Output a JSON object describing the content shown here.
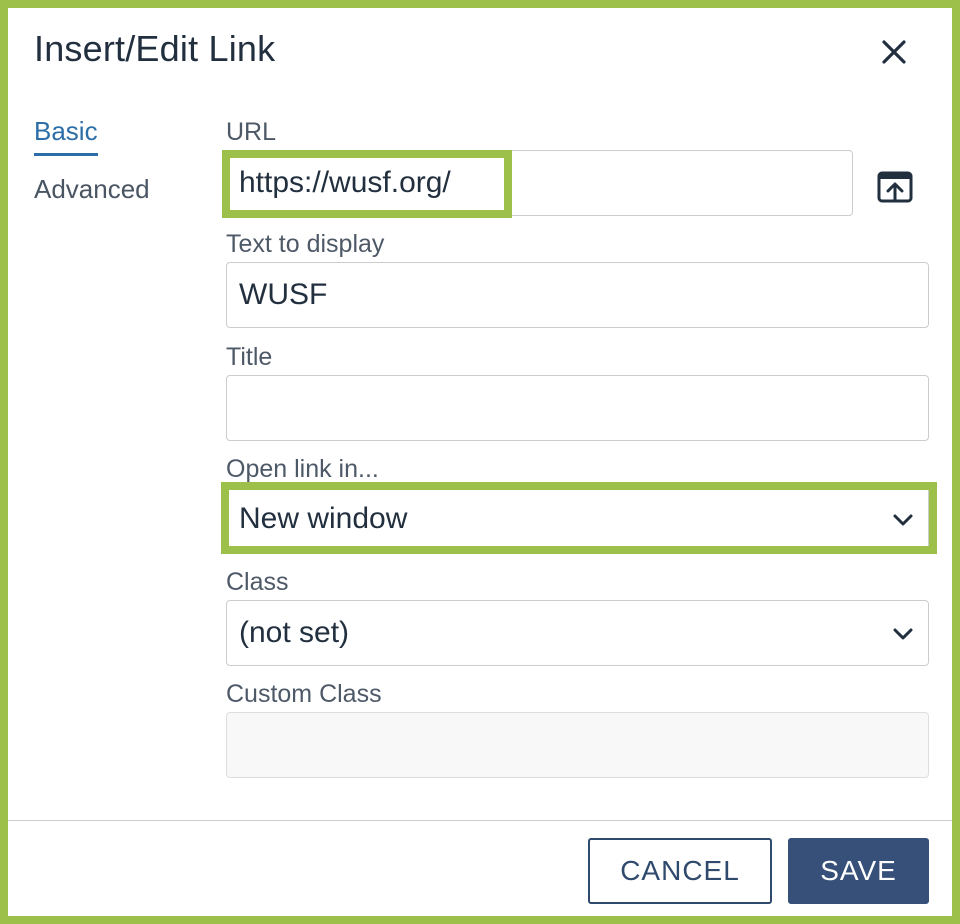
{
  "dialog": {
    "title": "Insert/Edit Link"
  },
  "tabs": [
    {
      "label": "Basic",
      "active": true
    },
    {
      "label": "Advanced",
      "active": false
    }
  ],
  "form": {
    "url": {
      "label": "URL",
      "value": "https://wusf.org/"
    },
    "text_to_display": {
      "label": "Text to display",
      "value": "WUSF"
    },
    "title": {
      "label": "Title",
      "value": ""
    },
    "open_link_in": {
      "label": "Open link in...",
      "value": "New window"
    },
    "class": {
      "label": "Class",
      "value": "(not set)"
    },
    "custom_class": {
      "label": "Custom Class",
      "value": ""
    }
  },
  "footer": {
    "cancel_label": "CANCEL",
    "save_label": "SAVE"
  },
  "colors": {
    "highlight": "#9cc04a",
    "active_tab": "#2b6ea8",
    "primary_button": "#36507a"
  },
  "icons": {
    "close": "close-icon",
    "browse": "upload-icon",
    "dropdown": "chevron-down-icon"
  }
}
